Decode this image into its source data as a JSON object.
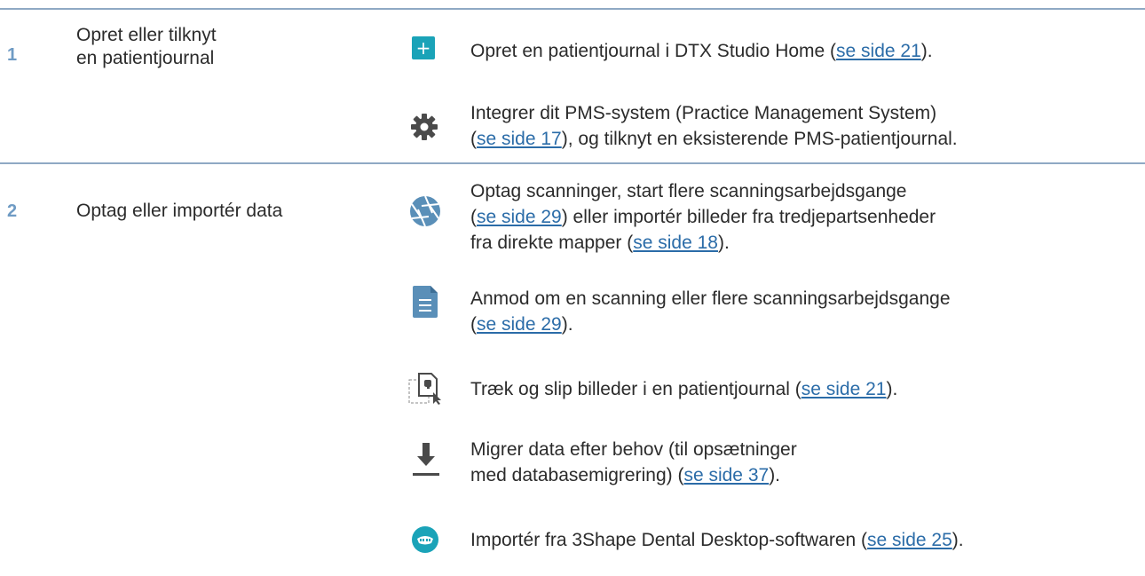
{
  "steps": [
    {
      "number": "1",
      "title_line1": "Opret eller tilknyt",
      "title_line2": "en patientjournal"
    },
    {
      "number": "2",
      "title_line1": "Optag eller importér data"
    }
  ],
  "items": {
    "create": {
      "pre": "Opret en patientjournal i DTX Studio Home (",
      "link": "se side 21",
      "post": ")."
    },
    "pms": {
      "line1": "Integrer dit PMS-system (Practice Management System)",
      "pre": "(",
      "link": "se side 17",
      "post": "), og tilknyt en eksisterende PMS-patientjournal."
    },
    "acquire": {
      "line1": "Optag scanninger, start flere scanningsarbejdsgange",
      "pre": "(",
      "link1": "se side 29",
      "mid": ") eller importér billeder fra tredjepartsenheder",
      "line3pre": "fra direkte mapper (",
      "link2": "se side 18",
      "post": ")."
    },
    "request": {
      "line1": "Anmod om en scanning eller flere scanningsarbejdsgange",
      "pre": "(",
      "link": "se side 29",
      "post": ")."
    },
    "dragdrop": {
      "pre": "Træk og slip billeder i en patientjournal (",
      "link": "se side 21",
      "post": ")."
    },
    "migrate": {
      "line1": "Migrer data efter behov (til opsætninger",
      "pre": "med databasemigrering) (",
      "link": "se side 37",
      "post": ")."
    },
    "import3shape": {
      "pre": "Importér fra 3Shape Dental Desktop-softwaren (",
      "link": "se side 25",
      "post": ")."
    }
  },
  "icons": {
    "plus": "plus-icon",
    "gear": "gear-icon",
    "aperture": "aperture-icon",
    "document": "document-icon",
    "dragdrop": "drag-drop-icon",
    "download": "download-icon",
    "dental": "3shape-dental-icon"
  },
  "colors": {
    "accent_teal": "#1aa3b8",
    "rule": "#8fa9c4",
    "step_number": "#6f9bc4",
    "link": "#2b6ca8",
    "icon_gray": "#4a4a4a",
    "icon_blue": "#5a8fb8"
  }
}
